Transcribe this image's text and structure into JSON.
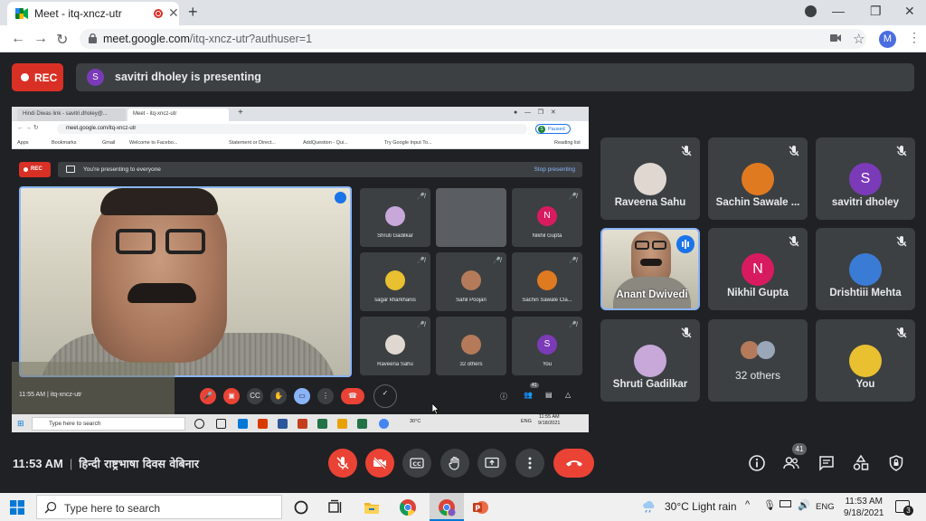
{
  "browser": {
    "tab_title": "Meet - itq-xncz-utr",
    "url_main": "meet.google.com",
    "url_rest": "/itq-xncz-utr?authuser=1",
    "profile_initial": "M"
  },
  "meet": {
    "rec_label": "REC",
    "presenter_initial": "S",
    "presenting_text": "savitri dholey is presenting",
    "time": "11:53 AM",
    "separator": "|",
    "meeting_title": "हिन्दी राष्ट्रभाषा दिवस वेबिनार",
    "participant_count": "41"
  },
  "participants": [
    {
      "name": "Raveena Sahu",
      "muted": true,
      "avatar_color": "#e0d8d0"
    },
    {
      "name": "Sachin Sawale ...",
      "muted": true,
      "avatar_color": "#e07a20"
    },
    {
      "name": "savitri dholey",
      "initial": "S",
      "muted": true,
      "avatar_color": "#7b3ab8"
    },
    {
      "name": "Anant Dwivedi",
      "muted": false,
      "speaking": true
    },
    {
      "name": "Nikhil Gupta",
      "initial": "N",
      "muted": true,
      "avatar_color": "#d81b60"
    },
    {
      "name": "Drishtiii Mehta",
      "muted": true,
      "avatar_color": "#3a7bd5"
    },
    {
      "name": "Shruti Gadilkar",
      "muted": true,
      "avatar_color": "#c7a8d8"
    },
    {
      "name": "32 others",
      "muted": false,
      "avatar_color": "#b47a5a"
    },
    {
      "name": "You",
      "muted": true,
      "avatar_color": "#e8c030"
    }
  ],
  "shared_screen": {
    "tab1": "Hindi Diwas link - savitri.dholey@...",
    "tab2": "Meet - itq-xncz-utr",
    "url": "meet.google.com/itq-xncz-utr",
    "paused_label": "Paused",
    "bookmarks": [
      "Apps",
      "Bookmarks",
      "Gmail",
      "Welcome to Facebo...",
      "Statement or Direct...",
      "AddQuestion - Qui...",
      "Try Google Input To...",
      "Reading list"
    ],
    "rec_label": "REC",
    "presenting_to_everyone": "You're presenting to everyone",
    "stop_presenting": "Stop presenting",
    "tiles": [
      {
        "name": "Shruti Gadilkar"
      },
      {
        "name": ""
      },
      {
        "name": "Nikhil Gupta",
        "initial": "N"
      },
      {
        "name": "sagar kharkhanis"
      },
      {
        "name": "Sahil Poojari"
      },
      {
        "name": "Sachin Sawale Cla..."
      },
      {
        "name": "Raveena Sahu"
      },
      {
        "name": "32 others"
      },
      {
        "name": "You",
        "initial": "S"
      }
    ],
    "time_meeting": "11:55 AM | itq-xncz-utr",
    "participant_count": "41",
    "taskbar_search": "Type here to search",
    "temp": "30°C",
    "lang": "ENG",
    "clock_time": "11:55 AM",
    "clock_date": "9/18/2021"
  },
  "taskbar": {
    "search_placeholder": "Type here to search",
    "weather": "30°C  Light rain",
    "lang": "ENG",
    "time": "11:53 AM",
    "date": "9/18/2021",
    "notifications": "3"
  }
}
